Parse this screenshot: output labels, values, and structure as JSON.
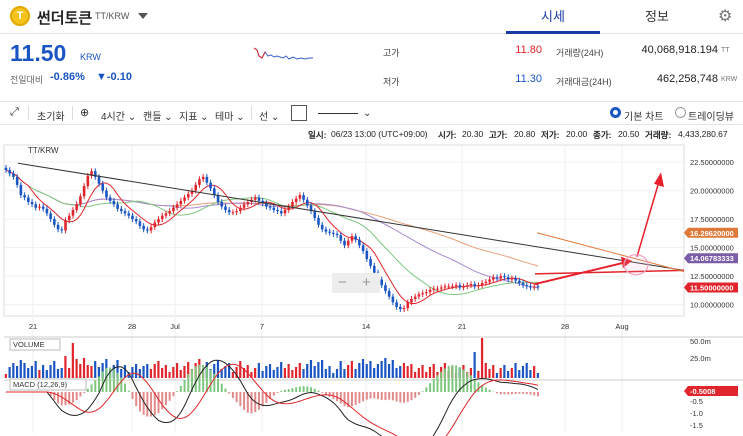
{
  "header": {
    "coin_name": "썬더토큰",
    "pair": "TT/KRW",
    "tab_quote": "시세",
    "tab_info": "정보"
  },
  "summary": {
    "price": "11.50",
    "unit": "KRW",
    "change_label": "전일대비",
    "change_pct": "-0.86%",
    "change_val": "▼-0.10",
    "high_label": "고가",
    "high": "11.80",
    "low_label": "저가",
    "low": "11.30",
    "vol_label": "거래량(24H)",
    "vol": "40,068,918.194",
    "vol_unit": "TT",
    "amt_label": "거래대금(24H)",
    "amt": "462,258,748",
    "amt_unit": "KRW",
    "colors": {
      "up": "#e0262c",
      "down": "#1a55c4"
    }
  },
  "toolbar": {
    "reset": "초기화",
    "interval": "4시간",
    "candle": "캔들",
    "indicator": "지표",
    "theme": "테마",
    "line": "선",
    "basic_chart": "기본 차트",
    "tradingview": "트레이딩뷰"
  },
  "info": {
    "date_label": "일시:",
    "date": "06/23 13:00 (UTC+09:00)",
    "open_label": "시가:",
    "open": "20.30",
    "high_label": "고가:",
    "high": "20.80",
    "low_label": "저가:",
    "low": "20.00",
    "close_label": "종가:",
    "close": "20.50",
    "vol_label": "거래량:",
    "vol": "4,433,280.67"
  },
  "chart_data": {
    "type": "candlestick",
    "title": "TT/KRW",
    "x_ticks": [
      "21",
      "28",
      "Jul",
      "7",
      "14",
      "21",
      "28",
      "Aug"
    ],
    "y_ticks": [
      "22.50000000",
      "20.00000000",
      "17.50000000",
      "15.00000000",
      "12.50000000",
      "10.00000000"
    ],
    "ylim": [
      9,
      24
    ],
    "close": [
      21.8,
      21.5,
      21.2,
      20.5,
      19.6,
      19.4,
      19.0,
      18.8,
      18.5,
      18.6,
      18.4,
      18.0,
      17.5,
      17.0,
      16.6,
      16.5,
      17.4,
      17.8,
      18.3,
      18.8,
      19.5,
      20.4,
      21.3,
      21.7,
      21.2,
      20.6,
      20.0,
      19.4,
      19.1,
      18.8,
      18.4,
      18.2,
      18.0,
      17.8,
      17.5,
      17.3,
      16.9,
      16.6,
      16.5,
      16.8,
      17.2,
      17.5,
      17.8,
      18.0,
      18.2,
      18.5,
      18.8,
      19.1,
      19.4,
      19.7,
      20.0,
      20.5,
      21.0,
      21.2,
      20.7,
      20.2,
      19.6,
      19.0,
      18.6,
      18.3,
      18.1,
      18.1,
      18.2,
      18.5,
      18.8,
      19.0,
      19.2,
      19.4,
      19.1,
      18.9,
      18.6,
      18.5,
      18.3,
      18.2,
      18.0,
      18.3,
      18.6,
      19.0,
      19.3,
      19.6,
      19.2,
      18.7,
      18.2,
      17.6,
      17.0,
      16.6,
      16.4,
      16.3,
      16.2,
      16.1,
      15.6,
      15.2,
      15.6,
      16.0,
      15.7,
      15.2,
      14.7,
      14.0,
      13.4,
      12.8,
      12.2,
      11.7,
      11.2,
      10.7,
      10.2,
      9.8,
      9.6,
      9.7,
      10.2,
      10.5,
      10.7,
      10.9,
      11.0,
      11.1,
      11.3,
      11.4,
      11.4,
      11.5,
      11.6,
      11.6,
      11.6,
      11.7,
      11.5,
      11.6,
      11.7,
      11.8,
      11.6,
      11.7,
      11.9,
      12.0,
      12.2,
      12.4,
      12.3,
      12.5,
      12.4,
      12.2,
      12.3,
      12.1,
      11.9,
      11.7,
      11.6,
      11.5,
      11.6,
      11.5
    ],
    "price_tags": [
      {
        "label": "16.29620000",
        "value": 16.3,
        "color": "#e07a3a"
      },
      {
        "label": "14.06783333",
        "value": 14.07,
        "color": "#7b5ea7"
      },
      {
        "label": "11.50000000",
        "value": 11.5,
        "color": "#e0262c"
      }
    ],
    "volume_label": "VOLUME",
    "volume_ticks": [
      "50.0m",
      "25.0m"
    ],
    "macd_label": "MACD (12,26,9)",
    "macd_ticks": [
      "0",
      "-0.5",
      "-1.0",
      "-1.5"
    ],
    "macd_tag": "-0.5008"
  }
}
